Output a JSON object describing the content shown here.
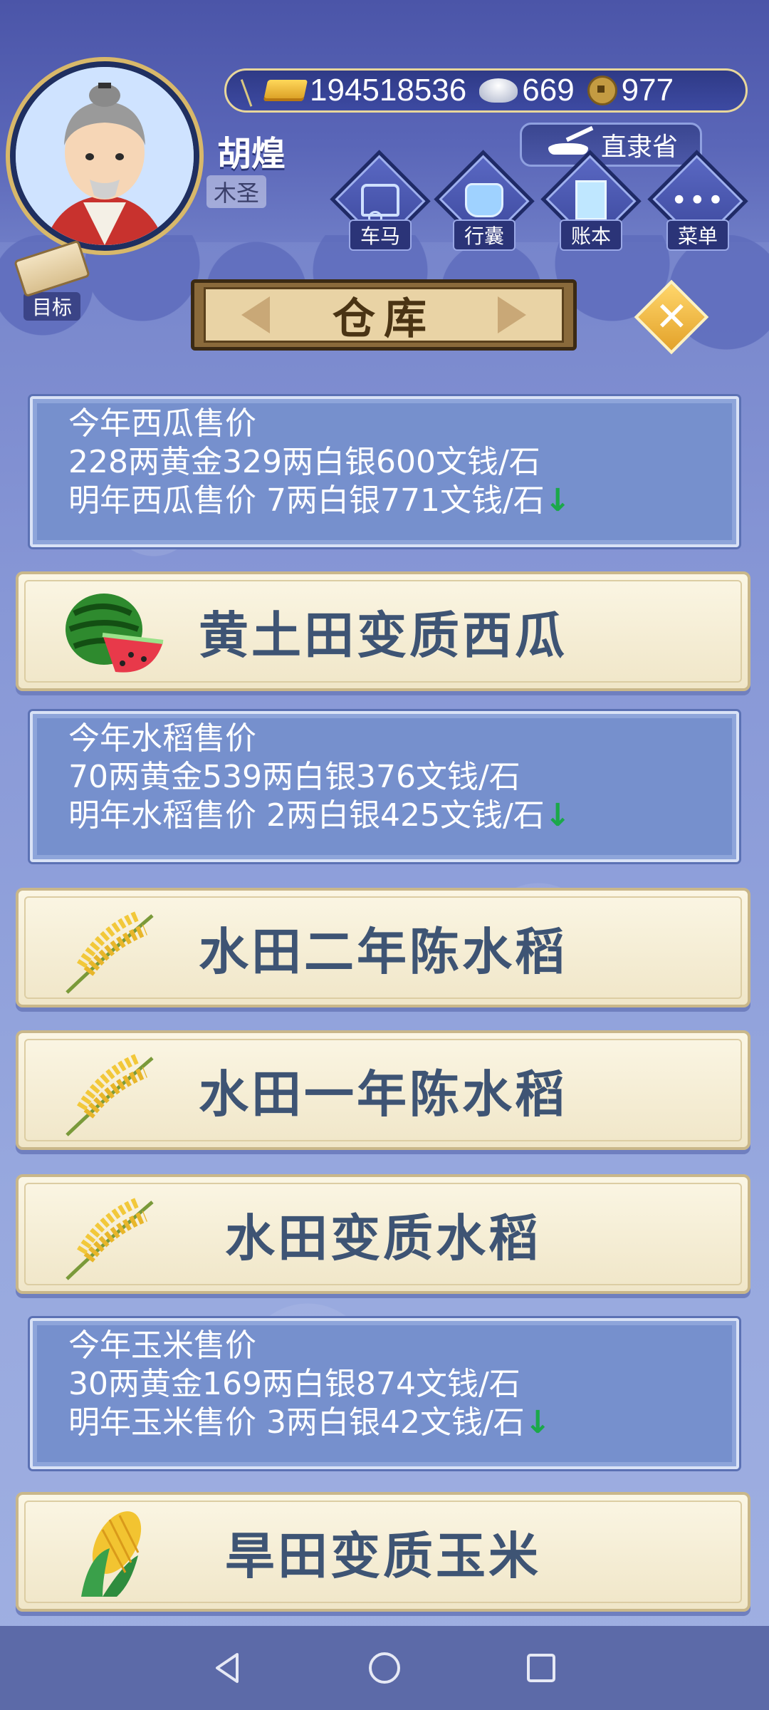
{
  "player": {
    "name": "胡煌",
    "title": "木圣"
  },
  "currency": {
    "gold": "194518536",
    "silver": "669",
    "coin": "977"
  },
  "province": "直隶省",
  "nav": [
    "车马",
    "行囊",
    "账本",
    "菜单"
  ],
  "target_label": "目标",
  "page_title": "仓库",
  "price_panels": [
    {
      "title": "今年西瓜售价",
      "this_year": "228两黄金329两白银600文钱/石",
      "next_year": "明年西瓜售价 7两白银771文钱/石",
      "trend": "↓"
    },
    {
      "title": "今年水稻售价",
      "this_year": "70两黄金539两白银376文钱/石",
      "next_year": "明年水稻售价 2两白银425文钱/石",
      "trend": "↓"
    },
    {
      "title": "今年玉米售价",
      "this_year": "30两黄金169两白银874文钱/石",
      "next_year": "明年玉米售价 3两白银42文钱/石",
      "trend": "↓"
    }
  ],
  "crops": [
    {
      "name": "黄土田变质西瓜",
      "icon": "watermelon-icon"
    },
    {
      "name": "水田二年陈水稻",
      "icon": "rice-icon"
    },
    {
      "name": "水田一年陈水稻",
      "icon": "rice-icon"
    },
    {
      "name": "水田变质水稻",
      "icon": "rice-icon"
    },
    {
      "name": "旱田变质玉米",
      "icon": "corn-icon"
    }
  ],
  "colors": {
    "panel": "#7690cd",
    "card": "#fbf6e4",
    "text_dark": "#3e5474",
    "trend_down": "#1ba84a"
  }
}
